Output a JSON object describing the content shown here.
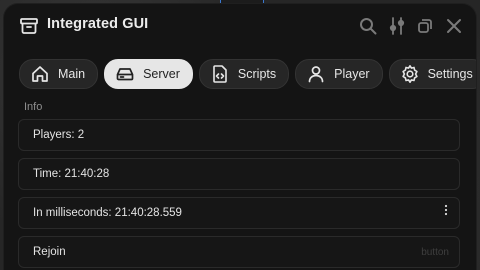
{
  "window": {
    "title": "Integrated GUI",
    "icons": {
      "app": "archive-box-icon",
      "search": "search-icon",
      "settings": "sliders-icon",
      "minimize": "minimize-icon",
      "close": "close-icon"
    }
  },
  "tabs": [
    {
      "label": "Main",
      "icon": "home-icon",
      "active": false
    },
    {
      "label": "Server",
      "icon": "server-icon",
      "active": true
    },
    {
      "label": "Scripts",
      "icon": "code-file-icon",
      "active": false
    },
    {
      "label": "Player",
      "icon": "user-icon",
      "active": false
    },
    {
      "label": "Settings",
      "icon": "gear-icon",
      "active": false
    }
  ],
  "section": {
    "label": "Info"
  },
  "rows": [
    {
      "text": "Players: 2"
    },
    {
      "text": "Time: 21:40:28"
    },
    {
      "text": "In milliseconds: 21:40:28.559"
    },
    {
      "text": "Rejoin",
      "hint": "button"
    }
  ],
  "colors": {
    "window_bg": "#141414",
    "row_bg": "#161616",
    "active_tab_bg": "#e6e6e6",
    "text": "#e4e4e4"
  }
}
